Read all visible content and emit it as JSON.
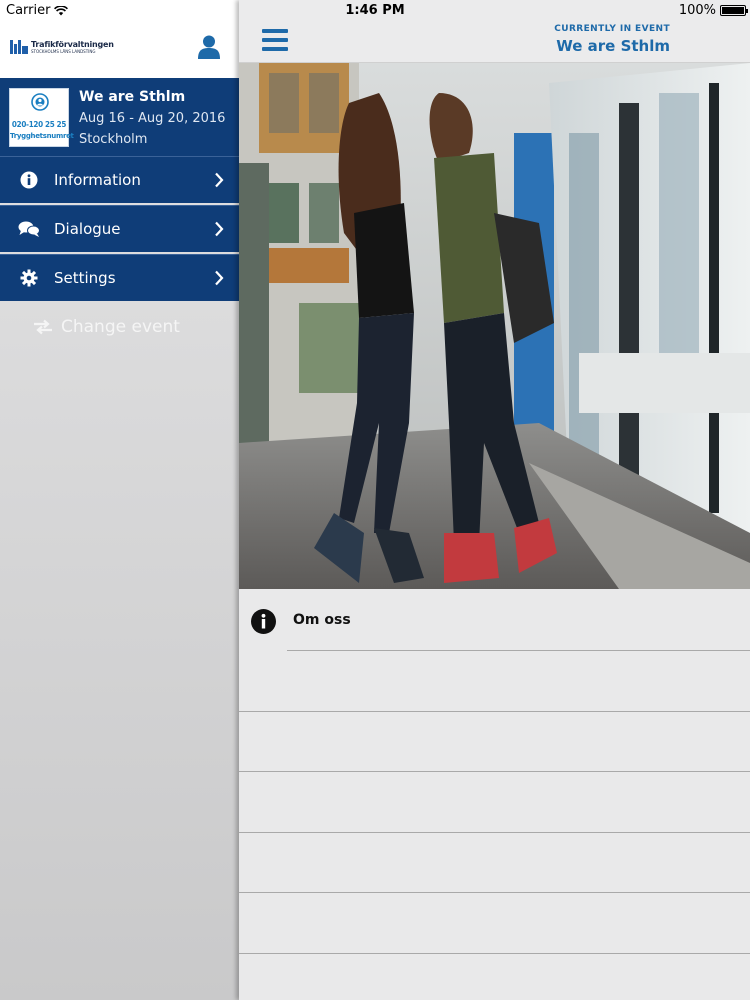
{
  "status_bar": {
    "carrier": "Carrier",
    "time": "1:46 PM",
    "battery": "100%"
  },
  "sidebar": {
    "logo": {
      "name": "Trafikförvaltningen",
      "subtitle": "STOCKHOLMS LÄNS LANDSTING"
    },
    "event": {
      "thumb_phone": "020-120 25 25",
      "thumb_label": "Trygghetsnumret",
      "title": "We are Sthlm",
      "dates": "Aug 16 - Aug 20, 2016",
      "city": "Stockholm"
    },
    "menu": [
      {
        "label": "Information",
        "icon": "info-icon"
      },
      {
        "label": "Dialogue",
        "icon": "chat-bubbles-icon"
      },
      {
        "label": "Settings",
        "icon": "gear-icon"
      }
    ],
    "change_event": "Change event"
  },
  "main": {
    "caption": "CURRENTLY IN EVENT",
    "event_name": "We are Sthlm",
    "list": [
      {
        "label": "Om oss",
        "icon": "info-icon"
      }
    ]
  },
  "colors": {
    "navy": "#0f3d78",
    "accent": "#1e6aa9"
  }
}
